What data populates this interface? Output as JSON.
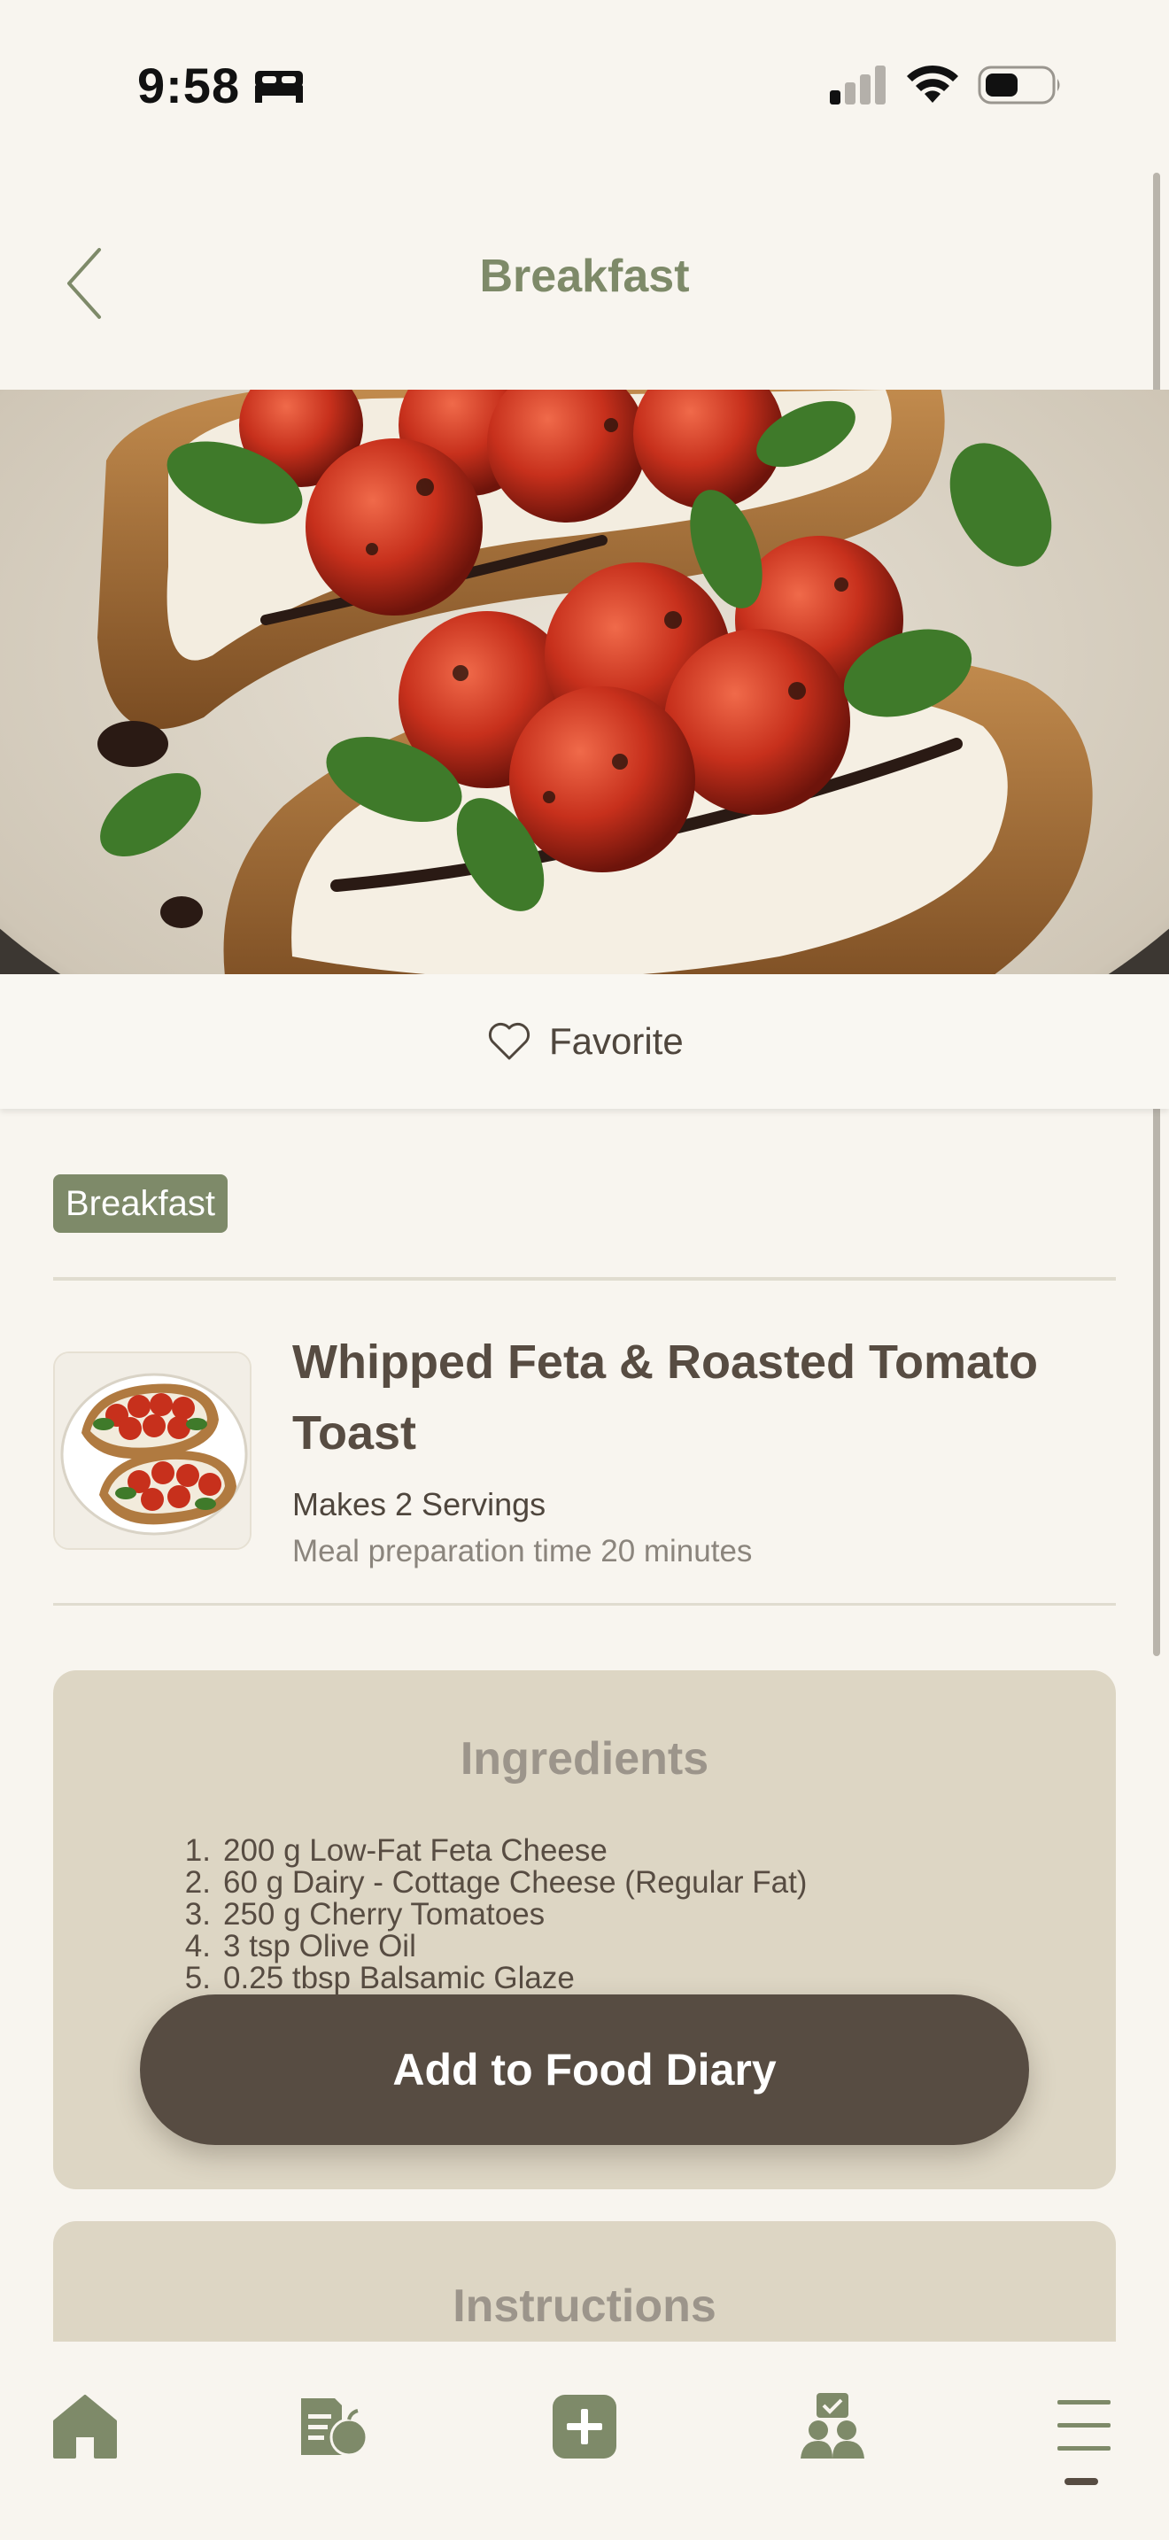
{
  "status_bar": {
    "time": "9:58",
    "icons": [
      "sleep-icon",
      "signal-icon",
      "wifi-icon",
      "battery-icon"
    ]
  },
  "header": {
    "title": "Breakfast",
    "back_icon": "chevron-left-icon"
  },
  "favorite": {
    "label": "Favorite",
    "icon": "heart-outline-icon"
  },
  "recipe": {
    "category": "Breakfast",
    "title": "Whipped Feta & Roasted Tomato Toast",
    "servings": "Makes 2 Servings",
    "prep_time": "Meal preparation time 20 minutes"
  },
  "ingredients": {
    "title": "Ingredients",
    "items": [
      {
        "num": "1.",
        "text": "200 g Low-Fat Feta Cheese"
      },
      {
        "num": "2.",
        "text": "60 g Dairy - Cottage Cheese (Regular Fat)"
      },
      {
        "num": "3.",
        "text": "250 g Cherry Tomatoes"
      },
      {
        "num": "4.",
        "text": "3 tsp Olive Oil"
      },
      {
        "num": "5.",
        "text": "0.25 tbsp Balsamic Glaze"
      }
    ]
  },
  "add_button": {
    "label": "Add to Food Diary"
  },
  "instructions": {
    "title": "Instructions"
  },
  "bottom_nav": {
    "items": [
      "home-icon",
      "food-diary-icon",
      "add-icon",
      "community-icon",
      "menu-icon"
    ],
    "active": "menu-icon"
  },
  "colors": {
    "background": "#f8f5ef",
    "accent_green": "#7e8a69",
    "text_brown": "#574c42",
    "card_beige": "#ddd6c4"
  }
}
